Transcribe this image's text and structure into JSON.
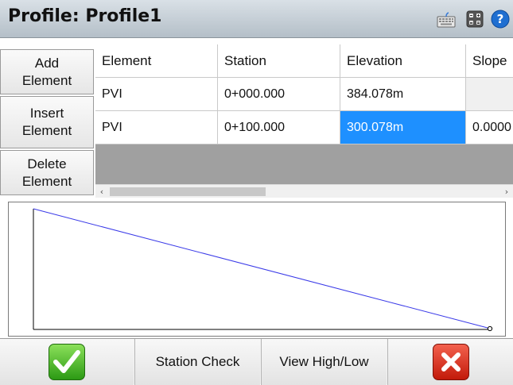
{
  "window": {
    "title": "Profile: Profile1"
  },
  "toolbar_icons": [
    "keyboard-icon",
    "calculator-icon",
    "help-icon"
  ],
  "side_buttons": {
    "add": [
      "Add",
      "Element"
    ],
    "insert": [
      "Insert",
      "Element"
    ],
    "delete": [
      "Delete",
      "Element"
    ]
  },
  "table": {
    "columns": [
      "Element",
      "Station",
      "Elevation",
      "Slope"
    ],
    "rows": [
      {
        "element": "PVI",
        "station": "0+000.000",
        "elevation": "384.078m",
        "slope": ""
      },
      {
        "element": "PVI",
        "station": "0+100.000",
        "elevation": "300.078m",
        "slope": "0.0000"
      }
    ],
    "selected_cell": "row 2, Elevation"
  },
  "scrollbar": {
    "left_arrow": "‹",
    "right_arrow": "›"
  },
  "plot": {
    "line_color": "#3a3ae8",
    "start_elevation": 384.078,
    "end_elevation": 300.078
  },
  "bottom_buttons": {
    "station_check": "Station Check",
    "view_high_low": "View High/Low"
  },
  "colors": {
    "selection": "#1e90ff",
    "accept": "#3cb01e",
    "cancel": "#d8281a"
  }
}
